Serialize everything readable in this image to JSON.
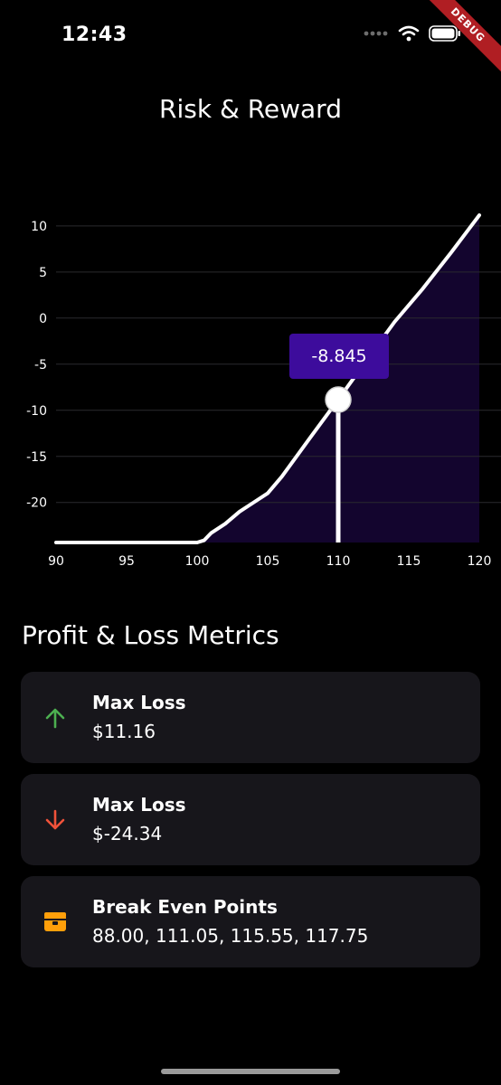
{
  "status_bar": {
    "time": "12:43",
    "debug_label": "DEBUG"
  },
  "title": "Risk & Reward",
  "chart_data": {
    "type": "area",
    "x": [
      90,
      95,
      100,
      100.5,
      101,
      102,
      103,
      104,
      105,
      106,
      108,
      110,
      112,
      114,
      116,
      118,
      120
    ],
    "y": [
      -24.34,
      -24.34,
      -24.34,
      -24.1,
      -23.3,
      -22.3,
      -21.0,
      -20.0,
      -19.0,
      -17.2,
      -13.0,
      -8.845,
      -4.6,
      -0.4,
      3.2,
      7.1,
      11.16
    ],
    "xlim": [
      90,
      120
    ],
    "ylim": [
      -24.34,
      11.16
    ],
    "x_ticks": [
      90,
      95,
      100,
      105,
      110,
      115,
      120
    ],
    "y_ticks": [
      10,
      5,
      0,
      -5,
      -10,
      -15,
      -20
    ],
    "grid": true,
    "line_color": "#ffffff",
    "fill_color": "#13052e",
    "selected_point": {
      "x": 110,
      "y": -8.845,
      "label": "-8.845"
    },
    "tooltip_color": "#3d0c9c"
  },
  "metrics_section": {
    "title": "Profit & Loss Metrics"
  },
  "metrics": [
    {
      "label": "Max Loss",
      "value": "$11.16",
      "icon": "arrow-up-icon",
      "color": "#4caf50"
    },
    {
      "label": "Max Loss",
      "value": "$-24.34",
      "icon": "arrow-down-icon",
      "color": "#f0523a"
    },
    {
      "label": "Break Even Points",
      "value": "88.00, 111.05, 115.55, 117.75",
      "icon": "balance-icon",
      "color": "#ff9f0a"
    }
  ]
}
